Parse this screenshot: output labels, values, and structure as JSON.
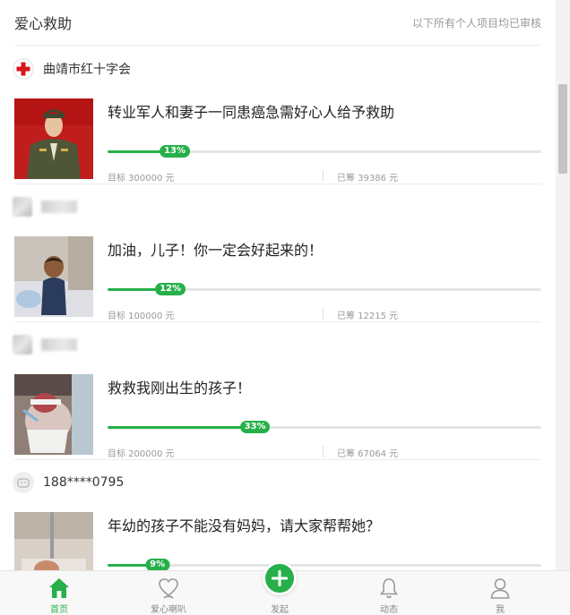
{
  "header": {
    "title": "爱心救助",
    "note": "以下所有个人项目均已审核"
  },
  "items": [
    {
      "org": "曲靖市红十字会",
      "title": "转业军人和妻子一同患癌急需好心人给予救助",
      "progress": 0.13,
      "progress_label": "13%",
      "goal": "目标 300000 元",
      "raised": "已筹 39386 元"
    },
    {
      "org": "",
      "title": "加油，儿子！你一定会好起来的！",
      "progress": 0.12,
      "progress_label": "12%",
      "goal": "目标 100000 元",
      "raised": "已筹 12215 元"
    },
    {
      "org": "",
      "title": "救救我刚出生的孩子！",
      "progress": 0.33,
      "progress_label": "33%",
      "goal": "目标 200000 元",
      "raised": "已筹 67064 元"
    },
    {
      "org": "188****0795",
      "title": "年幼的孩子不能没有妈妈，请大家帮帮她？",
      "progress": 0.09,
      "progress_label": "9%",
      "goal": "",
      "raised": ""
    }
  ],
  "tabs": [
    {
      "label": "首页",
      "icon": "home-icon",
      "active": true
    },
    {
      "label": "爱心喇叭",
      "icon": "heart-icon",
      "active": false
    },
    {
      "label": "发起",
      "icon": "plus-icon",
      "active": false
    },
    {
      "label": "动态",
      "icon": "bell-icon",
      "active": false
    },
    {
      "label": "我",
      "icon": "user-icon",
      "active": false
    }
  ],
  "colors": {
    "accent": "#27b04a",
    "red_cross": "#d7161c"
  }
}
